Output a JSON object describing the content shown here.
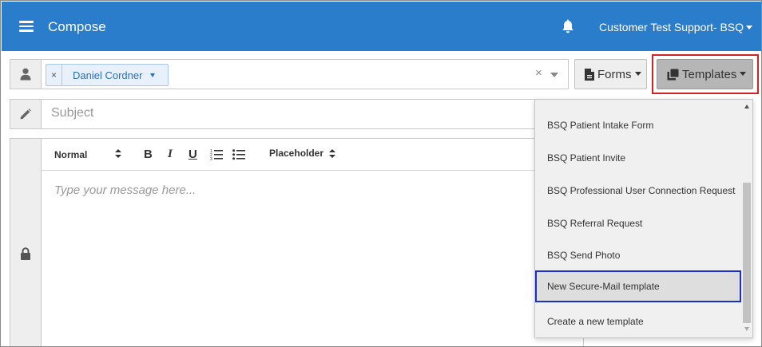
{
  "header": {
    "title": "Compose",
    "account": "Customer Test Support- BSQ",
    "menu_icon": "hamburger-menu-icon",
    "notification_icon": "bell-icon",
    "background_color": "#2a7dcb"
  },
  "recipients": {
    "icon": "person-icon",
    "chips": [
      {
        "name": "Daniel Cordner"
      }
    ],
    "chip_remove": "×",
    "clear": "×"
  },
  "toolbar_buttons": {
    "forms_label": "Forms",
    "forms_icon": "document-icon",
    "templates_label": "Templates",
    "templates_icon": "copy-icon"
  },
  "subject": {
    "icon": "pencil-icon",
    "placeholder": "Subject",
    "value": ""
  },
  "editor": {
    "lock_icon": "lock-icon",
    "format_select": "Normal",
    "placeholder_select": "Placeholder",
    "bold": "B",
    "italic": "I",
    "underline": "U",
    "message_placeholder": "Type your message here..."
  },
  "templates_menu": {
    "items": [
      {
        "label": "BSQ Patient Intake Form"
      },
      {
        "label": "BSQ Patient Invite"
      },
      {
        "label": "BSQ Professional User Connection Request"
      },
      {
        "label": "BSQ Referral Request"
      },
      {
        "label": "BSQ Send Photo"
      },
      {
        "label": "New Secure-Mail template"
      },
      {
        "label": "Create a new template"
      }
    ],
    "selected_index": 5
  }
}
